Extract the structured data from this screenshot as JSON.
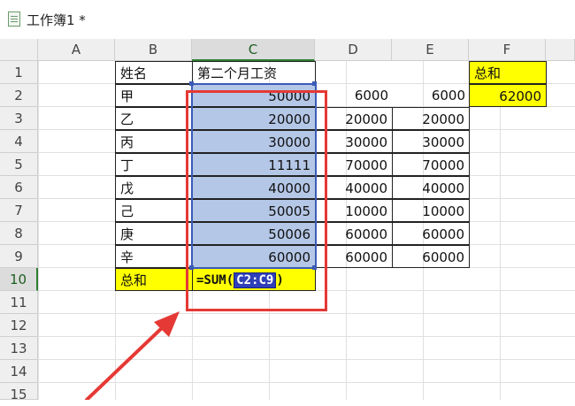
{
  "title": "工作簿1 *",
  "columns": [
    "A",
    "B",
    "C",
    "D",
    "E",
    "F"
  ],
  "rows": [
    "1",
    "2",
    "3",
    "4",
    "5",
    "6",
    "7",
    "8",
    "9",
    "10",
    "11",
    "12",
    "13",
    "14",
    "15"
  ],
  "header_b": "姓名",
  "header_c": "第二个月工资",
  "names": [
    "甲",
    "乙",
    "丙",
    "丁",
    "戊",
    "己",
    "庚",
    "辛"
  ],
  "col_c": [
    "50000",
    "20000",
    "30000",
    "11111",
    "40000",
    "50005",
    "50006",
    "60000"
  ],
  "col_d": [
    "6000",
    "20000",
    "30000",
    "70000",
    "40000",
    "10000",
    "60000",
    "60000"
  ],
  "col_e": [
    "6000",
    "20000",
    "30000",
    "70000",
    "40000",
    "10000",
    "60000",
    "60000"
  ],
  "total_label": "总和",
  "formula": {
    "prefix": "=SUM(",
    "ref": "C2:C9",
    "suffix": ")"
  },
  "f_label": "总和",
  "f_value": "62000",
  "colors": {
    "highlight_yellow": "#ffff00",
    "selection_blue": "#b4c7e7",
    "annotation_red": "#e53935"
  }
}
